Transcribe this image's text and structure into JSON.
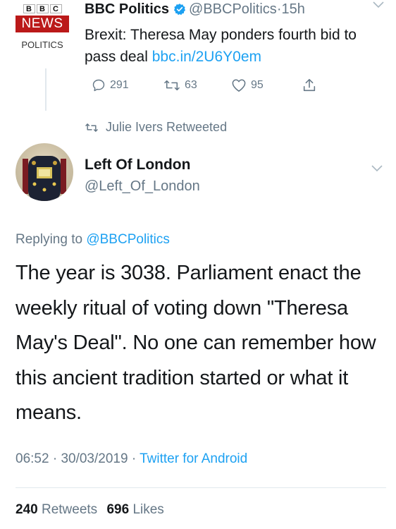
{
  "quoted_tweet": {
    "avatar": {
      "blocks": [
        "B",
        "B",
        "C"
      ],
      "news": "NEWS",
      "label": "POLITICS"
    },
    "name": "BBC Politics",
    "handle": "@BBCPolitics",
    "separator": "·",
    "time": "15h",
    "text": "Brexit: Theresa May ponders fourth bid to pass deal",
    "link": "bbc.in/2U6Y0em",
    "actions": {
      "replies": "291",
      "retweets": "63",
      "likes": "95"
    }
  },
  "retweet_notice": "Julie Ivers Retweeted",
  "main_tweet": {
    "author_name": "Left Of London",
    "author_handle": "@Left_Of_London",
    "replying_prefix": "Replying to",
    "replying_to": "@BBCPolitics",
    "text": "The year is 3038. Parliament enact the weekly ritual of voting down \"Theresa May's Deal\". No one can remember how this ancient tradition started or what it means.",
    "time": "06:52",
    "date": "30/03/2019",
    "source": "Twitter for Android",
    "retweets_count": "240",
    "retweets_label": "Retweets",
    "likes_count": "696",
    "likes_label": "Likes"
  },
  "colors": {
    "link": "#1da1f2",
    "muted": "#657786",
    "bbc_red": "#bb1919",
    "verified": "#1da1f2"
  },
  "icons": [
    "verified-badge-icon",
    "chevron-down-icon",
    "reply-icon",
    "retweet-icon",
    "like-icon",
    "share-icon"
  ]
}
